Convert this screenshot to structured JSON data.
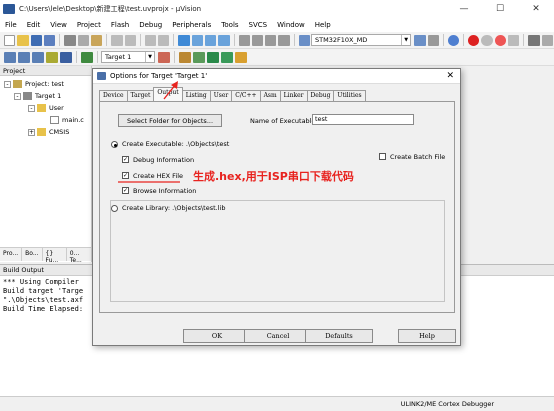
{
  "window": {
    "title": "C:\\Users\\lele\\Desktop\\新建工程\\test.uvprojx - µVision",
    "controls": [
      "—",
      "☐",
      "✕"
    ]
  },
  "menu": [
    "File",
    "Edit",
    "View",
    "Project",
    "Flash",
    "Debug",
    "Peripherals",
    "Tools",
    "SVCS",
    "Window",
    "Help"
  ],
  "toolbar": {
    "device_combo": "STM32F10X_MD",
    "target_combo": "Target 1"
  },
  "project_panel": {
    "header": "Project",
    "tree": [
      "Project: test",
      "Target 1",
      "User",
      "main.c",
      "CMSIS"
    ],
    "tree_expanders": [
      "-",
      "-",
      "-",
      "+"
    ],
    "tabs": [
      "Pro...",
      "Bo...",
      "{} Fu...",
      "0... Te..."
    ]
  },
  "build_output": {
    "header": "Build Output",
    "lines": [
      "*** Using Compiler",
      "Build target 'Targe",
      "\".\\Objects\\test.axf",
      "Build Time Elapsed:"
    ]
  },
  "status_bar": {
    "debugger": "ULINK2/ME Cortex Debugger"
  },
  "dialog": {
    "title": "Options for Target 'Target 1'",
    "tabs": [
      "Device",
      "Target",
      "Output",
      "Listing",
      "User",
      "C/C++",
      "Asm",
      "Linker",
      "Debug",
      "Utilities"
    ],
    "active_tab": "Output",
    "select_folder_button": "Select Folder for Objects...",
    "name_of_executable_label": "Name of Executable:",
    "name_of_executable_value": "test",
    "create_executable_label": "Create Executable:  .\\Objects\\test",
    "debug_information_label": "Debug Information",
    "create_hex_label": "Create HEX File",
    "browse_information_label": "Browse Information",
    "create_batch_label": "Create Batch File",
    "create_library_label": "Create Library:  .\\Objects\\test.lib",
    "checks": {
      "debug_information": "✓",
      "create_hex": "✓",
      "browse_information": "✓",
      "create_batch": ""
    },
    "buttons": {
      "ok": "OK",
      "cancel": "Cancel",
      "defaults": "Defaults",
      "help": "Help"
    }
  },
  "annotation": "生成.hex,用于ISP串口下载代码",
  "colors": {
    "annotation": "#e8231f"
  }
}
